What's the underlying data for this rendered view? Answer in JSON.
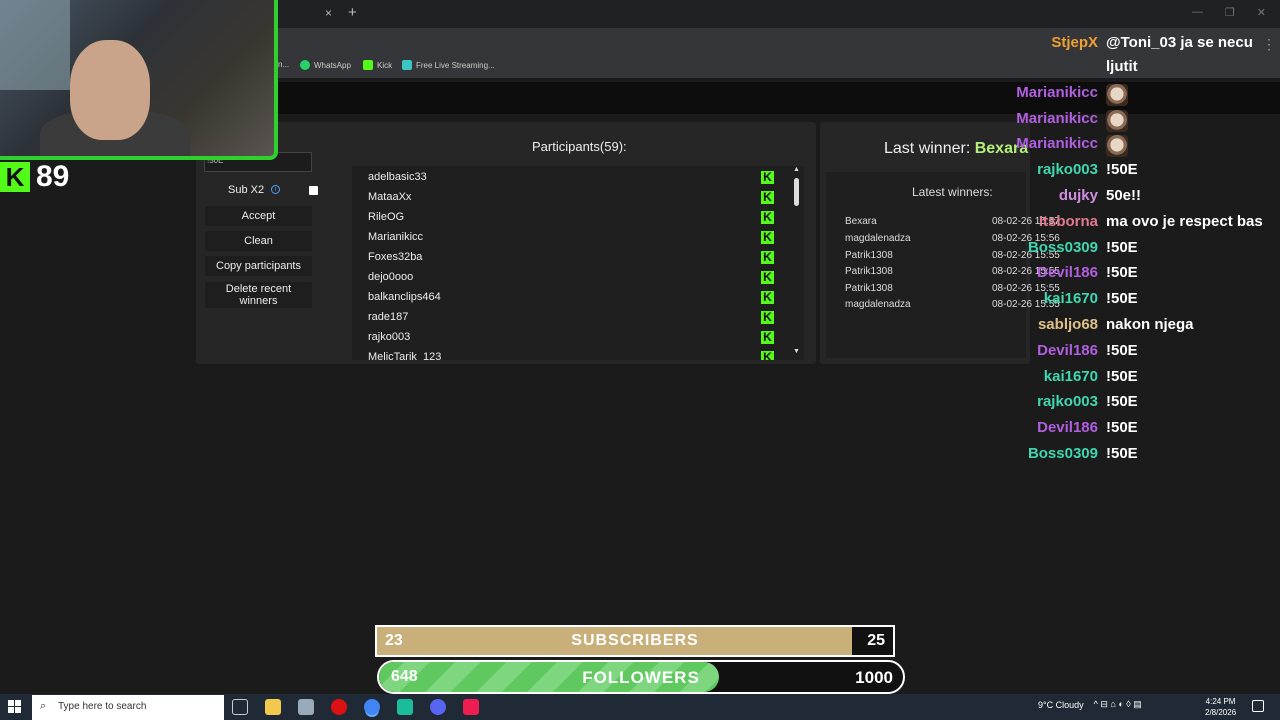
{
  "browser": {
    "tab_close": "×",
    "tab_new": "+",
    "window_controls": [
      "—",
      "❐",
      "✕"
    ],
    "bookmarks": [
      {
        "label": "n...",
        "color": "#35363a"
      },
      {
        "label": "WhatsApp",
        "color": "#25d366"
      },
      {
        "label": "Kick",
        "color": "#53fc18"
      },
      {
        "label": "Free Live Streaming...",
        "color": "#3ec6c6"
      }
    ]
  },
  "stream_overlay": {
    "kick_logo": "K",
    "viewer_count": "89"
  },
  "app": {
    "command_input": "!50E",
    "sub_x2_label": "Sub X2",
    "sub_x2_info": "i",
    "buttons": {
      "accept": "Accept",
      "clean": "Clean",
      "copy": "Copy participants",
      "delete_recent": "Delete recent winners"
    },
    "participants_title": "Participants(59):",
    "participants": [
      "adelbasic33",
      "MataaXx",
      "RileOG",
      "Marianikicc",
      "Foxes32ba",
      "dejo0ooo",
      "balkanclips464",
      "rade187",
      "rajko003",
      "MelicTarik_123"
    ],
    "kick_badge": "K",
    "scroll_up": "▲",
    "scroll_down": "▼",
    "last_winner_label": "Last winner:",
    "last_winner_name": "Bexara",
    "latest_winners_title": "Latest winners:",
    "latest_winners": [
      {
        "name": "Bexara",
        "time": "08-02-26 15:57"
      },
      {
        "name": "magdalenadza",
        "time": "08-02-26 15:56"
      },
      {
        "name": "Patrik1308",
        "time": "08-02-26 15:55"
      },
      {
        "name": "Patrik1308",
        "time": "08-02-26 15:55"
      },
      {
        "name": "Patrik1308",
        "time": "08-02-26 15:55"
      },
      {
        "name": "magdalenadza",
        "time": "08-02-26 15:55"
      }
    ]
  },
  "chat": {
    "menu_icon": "⋮",
    "messages": [
      {
        "user": "StjepX",
        "color": "#f0a030",
        "text": "@Toni_03 ja se necu",
        "text2": "ljutit"
      },
      {
        "user": "Marianikicc",
        "color": "#b15fe0",
        "emote": true
      },
      {
        "user": "Marianikicc",
        "color": "#b15fe0",
        "emote": true
      },
      {
        "user": "Marianikicc",
        "color": "#b15fe0",
        "emote": true
      },
      {
        "user": "rajko003",
        "color": "#3fd6b0",
        "text": "!50E"
      },
      {
        "user": "dujky",
        "color": "#d08fe0",
        "text": "50e!!"
      },
      {
        "user": "Itsborna",
        "color": "#e07a8f",
        "text": "ma ovo je respect bas"
      },
      {
        "user": "Boss0309",
        "color": "#3fd6b0",
        "text": "!50E"
      },
      {
        "user": "Devil186",
        "color": "#b15fe0",
        "text": "!50E"
      },
      {
        "user": "kai1670",
        "color": "#3fd6b0",
        "text": "!50E"
      },
      {
        "user": "sabljo68",
        "color": "#e0c08a",
        "text": "nakon njega"
      },
      {
        "user": "Devil186",
        "color": "#b15fe0",
        "text": "!50E"
      },
      {
        "user": "kai1670",
        "color": "#3fd6b0",
        "text": "!50E"
      },
      {
        "user": "rajko003",
        "color": "#3fd6b0",
        "text": "!50E"
      },
      {
        "user": "Devil186",
        "color": "#b15fe0",
        "text": "!50E"
      },
      {
        "user": "Boss0309",
        "color": "#3fd6b0",
        "text": "!50E"
      }
    ]
  },
  "goals": {
    "subscribers": {
      "current": "23",
      "label": "SUBSCRIBERS",
      "goal": "25",
      "fraction": 0.92
    },
    "followers": {
      "current": "648",
      "label": "FOLLOWERS",
      "goal": "1000",
      "fraction": 0.648
    }
  },
  "taskbar": {
    "search_placeholder": "Type here to search",
    "search_icon": "⌕",
    "weather": "9°C  Cloudy",
    "tray_icons": "^  ⊟  ⌂  ◐  ◊  ▤",
    "time": "4:24 PM",
    "date": "2/8/2026"
  }
}
